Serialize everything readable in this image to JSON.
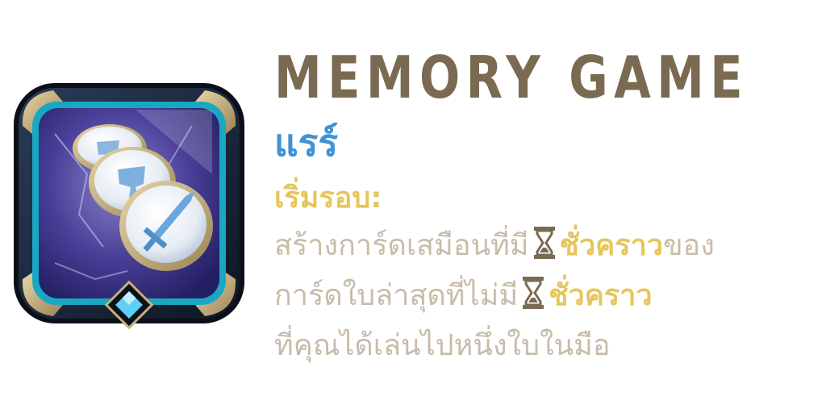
{
  "card": {
    "title": "MEMORY GAME",
    "rarity": "แรร์",
    "trigger_label": "เริ่มรอบ:",
    "description": {
      "line1_a": "สร้างการ์ดเสมือนที่มี",
      "line1_icon": "hourglass-icon",
      "line1_hl": "ชั่วคราว",
      "line1_b": "ของ",
      "line2_a": "การ์ดใบล่าสุดที่ไม่มี",
      "line2_icon": "hourglass-icon",
      "line2_hl": "ชั่วคราว",
      "line3": "ที่คุณได้เล่นไปหนึ่งใบในมือ"
    },
    "icon": "memory-coins-icon",
    "colors": {
      "title": "#7a6a52",
      "rarity": "#3f92d4",
      "highlight": "#e6c55a",
      "description": "#c8bca9",
      "gem": "#5fd0f5"
    }
  }
}
